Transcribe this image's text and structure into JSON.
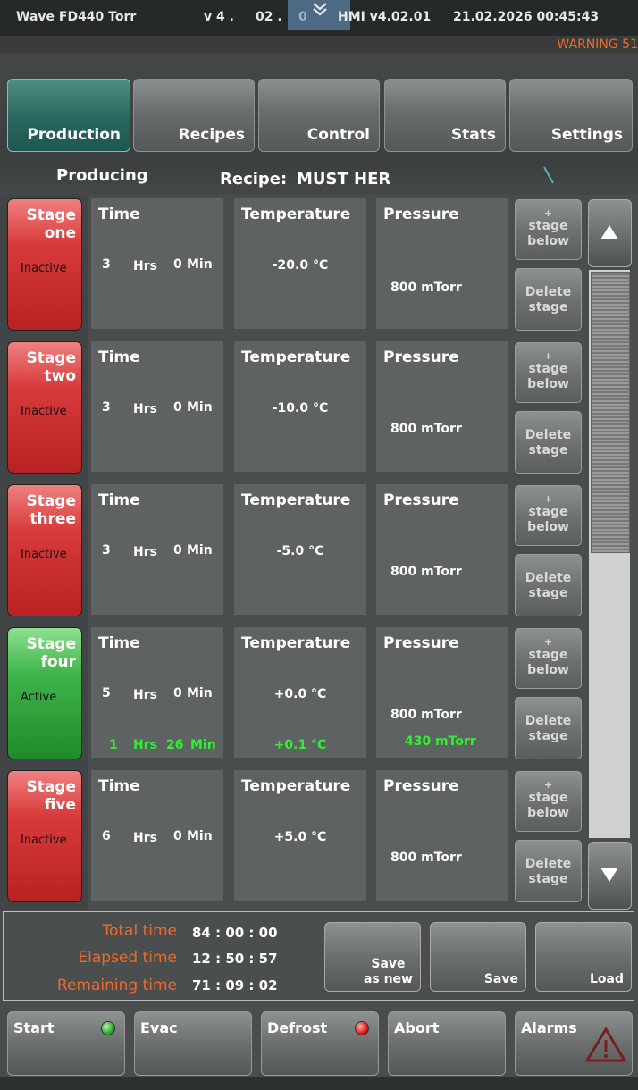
{
  "header": {
    "title": "Wave FD440 Torr",
    "version_left": "v 4 .",
    "version_mid": "02 .",
    "version_right": "0",
    "hmi": "HMI v4.02.01",
    "datetime": "21.02.2026 00:45:43",
    "warning": "WARNING 51"
  },
  "nav": {
    "tabs": [
      {
        "label": "Production"
      },
      {
        "label": "Recipes"
      },
      {
        "label": "Control"
      },
      {
        "label": "Stats"
      },
      {
        "label": "Settings"
      }
    ]
  },
  "status": {
    "mode": "Producing",
    "recipe_label": "Recipe:",
    "recipe_name": "MUST HER"
  },
  "headings": {
    "time": "Time",
    "temperature": "Temperature",
    "pressure": "Pressure"
  },
  "units": {
    "hrs": "Hrs",
    "min": "Min"
  },
  "stage_buttons": {
    "add_line1": "+",
    "add_line2": "stage",
    "add_line3": "below",
    "delete_line1": "Delete",
    "delete_line2": "stage"
  },
  "stages": [
    {
      "name_1": "Stage",
      "name_2": "one",
      "state": "Inactive",
      "hours": "3",
      "minutes": "0",
      "temperature": "-20.0 °C",
      "pressure": "800 mTorr"
    },
    {
      "name_1": "Stage",
      "name_2": "two",
      "state": "Inactive",
      "hours": "3",
      "minutes": "0",
      "temperature": "-10.0 °C",
      "pressure": "800 mTorr"
    },
    {
      "name_1": "Stage",
      "name_2": "three",
      "state": "Inactive",
      "hours": "3",
      "minutes": "0",
      "temperature": "-5.0 °C",
      "pressure": "800 mTorr"
    },
    {
      "name_1": "Stage",
      "name_2": "four",
      "state": "Active",
      "hours": "5",
      "minutes": "0",
      "temperature": "+0.0 °C",
      "pressure": "800 mTorr",
      "actual_hours": "1",
      "actual_minutes": "26",
      "actual_temperature": "+0.1 °C",
      "actual_pressure": "430 mTorr"
    },
    {
      "name_1": "Stage",
      "name_2": "five",
      "state": "Inactive",
      "hours": "6",
      "minutes": "0",
      "temperature": "+5.0 °C",
      "pressure": "800 mTorr"
    }
  ],
  "totals": {
    "total_label": "Total time",
    "total_value": "84 :  00 : 00",
    "elapsed_label": "Elapsed time",
    "elapsed_value": "12 :  50 : 57",
    "remaining_label": "Remaining time",
    "remaining_value": "71 :  09 : 02"
  },
  "actions": {
    "save_as_new_1": "Save",
    "save_as_new_2": "as new",
    "save": "Save",
    "load": "Load"
  },
  "controls": {
    "start": "Start",
    "evac": "Evac",
    "defrost": "Defrost",
    "abort": "Abort",
    "alarms": "Alarms"
  },
  "colors": {
    "active_tab": "#2a6a60",
    "stage_inactive": "#d83a3a",
    "stage_active": "#3fb54a",
    "warning_text": "#ee6a2a",
    "live_value": "#2ef02e"
  },
  "scrollbar": {
    "position": 0,
    "visible_fraction": 0.5
  }
}
